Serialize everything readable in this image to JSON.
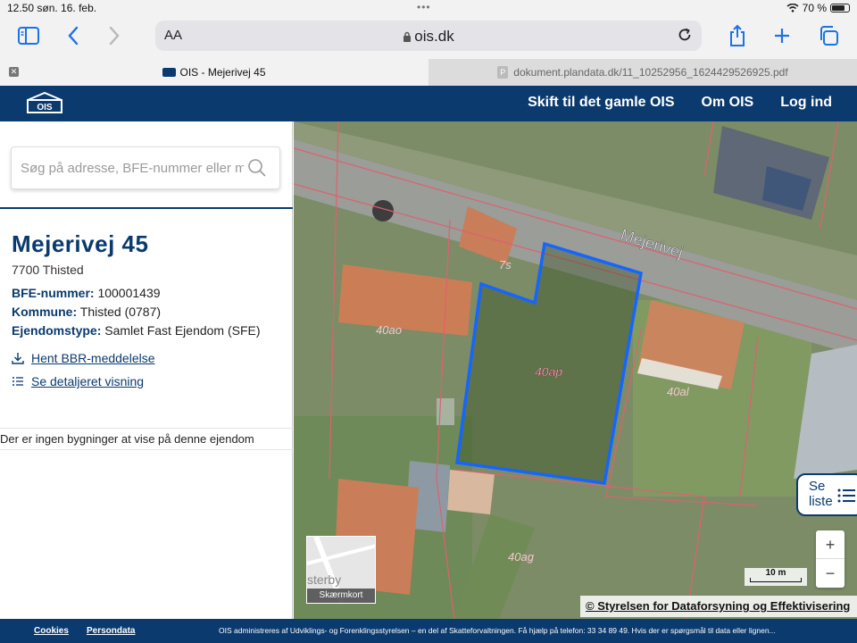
{
  "status_bar": {
    "time": "12.50",
    "date": "søn. 16. feb.",
    "battery": "70 %"
  },
  "browser": {
    "aa_label": "AA",
    "url": "ois.dk",
    "tabs": [
      {
        "label": "OIS - Mejerivej 45"
      },
      {
        "label": "dokument.plandata.dk/11_10252956_1624429526925.pdf"
      }
    ]
  },
  "header": {
    "logo_text": "OIS",
    "nav": [
      "Skift til det gamle OIS",
      "Om OIS",
      "Log ind"
    ]
  },
  "panel": {
    "search_placeholder": "Søg på adresse, BFE-nummer eller m",
    "title": "Mejerivej 45",
    "postal": "7700 Thisted",
    "fields": [
      {
        "label": "BFE-nummer:",
        "value": "100001439"
      },
      {
        "label": "Kommune:",
        "value": "Thisted (0787)"
      },
      {
        "label": "Ejendomstype:",
        "value": "Samlet Fast Ejendom (SFE)"
      }
    ],
    "links": [
      "Hent BBR-meddelelse",
      "Se detaljeret visning"
    ],
    "no_buildings": "Der er ingen bygninger at vise på denne ejendom"
  },
  "map": {
    "street_label": "Mejerivej",
    "parcel_labels": [
      "7s",
      "40ao",
      "40ap",
      "40al",
      "40ag"
    ],
    "se_liste": [
      "Se",
      "liste"
    ],
    "zoom_in": "+",
    "zoom_out": "−",
    "scale": "10 m",
    "minimap_label": "Skærmkort",
    "minimap_text": "sterby",
    "attribution": "© Styrelsen for Dataforsyning og Effektivisering"
  },
  "footer": {
    "links": [
      "Cookies",
      "Persondata"
    ],
    "text": "OIS administreres af Udviklings- og Forenklingsstyrelsen – en del af Skatteforvaltningen. Få hjælp på telefon: 33 34 89 49. Hvis der er spørgsmål til data eller lignen..."
  },
  "colors": {
    "brand": "#0b3a6e",
    "parcel_outline": "#1565ff",
    "cadastre_lines": "#e06070"
  }
}
